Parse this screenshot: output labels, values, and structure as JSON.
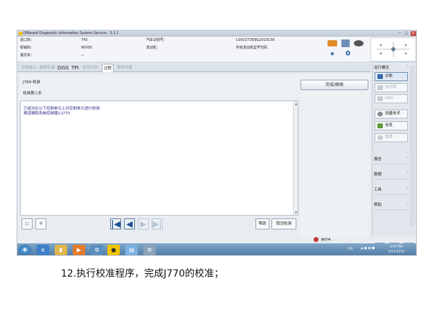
{
  "window": {
    "title": "Offboard Diagnostic Information System Service - 3.1.1"
  },
  "info": {
    "importer_label": "进口商：",
    "importer_value": "743",
    "dealer_label": "经销商：",
    "dealer_value": "90000",
    "order_label": "委托单：",
    "order_value": "—",
    "vin_label": "汽车识别号：",
    "vin_value": "LSVCD73E9G2010136",
    "engine_label": "发动机：",
    "engine_value": "所有发动机型号代码",
    "badge_count": "0"
  },
  "tabs": [
    {
      "label": "控制单元"
    },
    {
      "label": "故障存储"
    },
    {
      "label": "DISS"
    },
    {
      "label": "TPI"
    },
    {
      "label": "检测计划"
    },
    {
      "label": "过程"
    },
    {
      "label": "服务测量"
    }
  ],
  "step": {
    "line1": "J769-校准",
    "line2": "校准第二步"
  },
  "content": {
    "line1": "已成功在以下控制单元上对控制单元进行校准：",
    "line2": "换道辅助系统控制器2-J770"
  },
  "done_button": "完成/继续",
  "nav": {
    "help": "帮助",
    "cancel": "取消检测"
  },
  "sidebar": {
    "mode_header": "运行模式",
    "items": [
      {
        "label": "诊断",
        "icon": "stethoscope-icon",
        "enabled": true
      },
      {
        "label": "自诊断",
        "icon": "car-icon",
        "enabled": false
      },
      {
        "label": "OBD",
        "icon": "obd-icon",
        "enabled": false
      },
      {
        "label": "测量技术",
        "icon": "meter-icon",
        "enabled": true
      },
      {
        "label": "信息",
        "icon": "info-icon",
        "enabled": true
      },
      {
        "label": "管理",
        "icon": "admin-icon",
        "enabled": false
      }
    ],
    "sections": [
      {
        "label": "报告"
      },
      {
        "label": "数据"
      },
      {
        "label": "工具"
      },
      {
        "label": "帮助"
      }
    ]
  },
  "statusbar": {
    "text": "执行中..."
  },
  "tray": {
    "lang": "EN",
    "time": "3:07 PM",
    "date": "9/11/2016"
  },
  "caption": "12.执行校准程序，完成J770的校准；"
}
